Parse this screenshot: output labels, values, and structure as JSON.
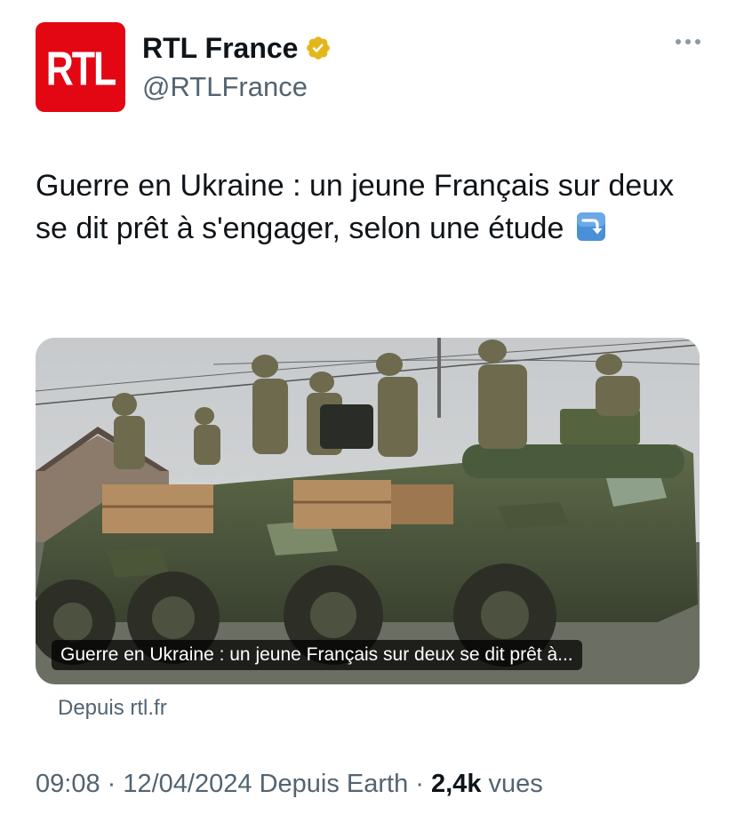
{
  "account": {
    "avatar_text": "RTL",
    "display_name": "RTL France",
    "handle": "@RTLFrance",
    "verified_icon": "verified-badge-gold"
  },
  "tweet": {
    "text": "Guerre en Ukraine : un jeune Français sur deux se dit prêt à s'engager, selon une étude",
    "emoji": "right-arrow-curving-down"
  },
  "card": {
    "caption": "Guerre en Ukraine : un jeune Français sur deux se dit prêt à...",
    "source": "Depuis rtl.fr"
  },
  "meta": {
    "time": "09:08",
    "sep1": " · ",
    "date": "12/04/2024",
    "client": " Depuis Earth",
    "sep2": " · ",
    "views_count": "2,4k",
    "views_label": " vues"
  },
  "colors": {
    "brand_red": "#e30613",
    "verified_gold": "#e2b719",
    "secondary_text": "#536471",
    "primary_text": "#0f1419"
  }
}
